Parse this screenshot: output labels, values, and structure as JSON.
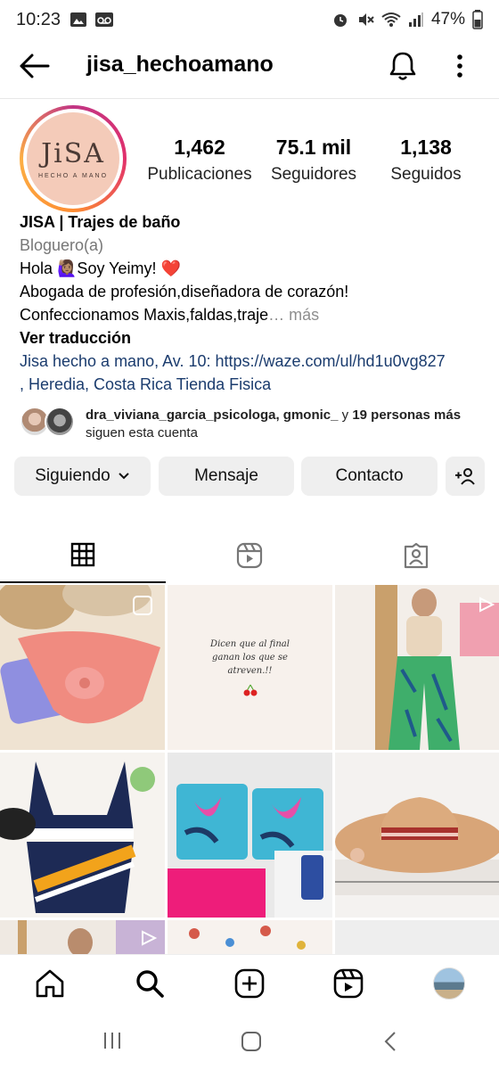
{
  "status_bar": {
    "time": "10:23",
    "battery": "47%",
    "icons_left": [
      "image-icon",
      "voicemail-icon"
    ],
    "icons_right": [
      "alarm-icon",
      "mute-icon",
      "wifi-icon",
      "signal-icon",
      "battery-icon"
    ]
  },
  "header": {
    "username": "jisa_hechoamano"
  },
  "profile": {
    "avatar_logo": "JiSA",
    "avatar_sub": "HECHO A MANO",
    "stats": [
      {
        "value": "1,462",
        "label": "Publicaciones"
      },
      {
        "value": "75.1 mil",
        "label": "Seguidores"
      },
      {
        "value": "1,138",
        "label": "Seguidos"
      }
    ],
    "name": "JISA |  Trajes de baño",
    "category": "Bloguero(a)",
    "bio_line1": "Hola 🙋🏽‍♀️Soy Yeimy! ❤️",
    "bio_line2": "Abogada de profesión,diseñadora de corazón!",
    "bio_line3": "Confeccionamos Maxis,faldas,traje",
    "bio_ellipsis": "… ",
    "more": "más",
    "translate": "Ver traducción",
    "location_line1": "Jisa hecho a mano, Av. 10: https://waze.com/ul/hd1u0vg827",
    "location_line2": ", Heredia, Costa Rica Tienda Fisica"
  },
  "followers_preview": {
    "names": "dra_viviana_garcia_psicologa, gmonic_",
    "connector": " y ",
    "count": "19 personas más",
    "suffix": "siguen esta cuenta"
  },
  "actions": {
    "following": "Siguiendo",
    "message": "Mensaje",
    "contact": "Contacto"
  },
  "grid_posts": [
    {
      "text": ""
    },
    {
      "text": "Dicen que al final ganan los que se atreven.!!"
    },
    {
      "text": ""
    }
  ],
  "colors": {
    "link": "#1b3c6e",
    "button_bg": "#efefef",
    "secondary_text": "#8e8e8e"
  }
}
